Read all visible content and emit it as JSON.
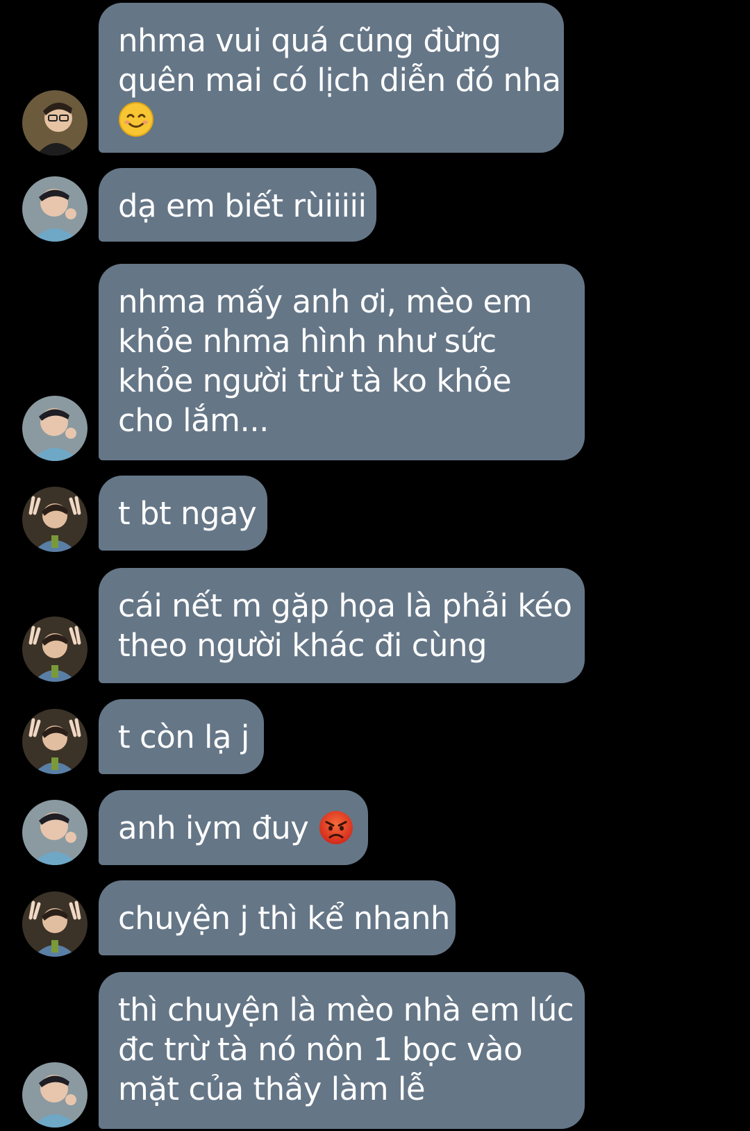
{
  "messages": [
    {
      "sender": "avatar-glasses",
      "lines": [
        "nhma vui quá cũng đừng",
        "quên mai có lịch diễn đó nha"
      ],
      "emoji": "smiling-face-emoji"
    },
    {
      "sender": "avatar-duy",
      "lines": [
        "dạ em biết rùiiiii"
      ]
    },
    {
      "sender": "avatar-duy",
      "lines": [
        "nhma mấy anh ơi, mèo em",
        "khỏe nhma hình như sức",
        "khỏe người trừ tà ko khỏe",
        "cho lắm..."
      ]
    },
    {
      "sender": "avatar-peace",
      "lines": [
        "t bt ngay"
      ]
    },
    {
      "sender": "avatar-peace",
      "lines": [
        "cái nết m gặp họa là phải kéo",
        "theo người khác đi cùng"
      ]
    },
    {
      "sender": "avatar-peace",
      "lines": [
        "t còn lạ j"
      ]
    },
    {
      "sender": "avatar-duy",
      "lines": [
        "anh iym đuy "
      ],
      "emoji": "angry-face-emoji"
    },
    {
      "sender": "avatar-peace",
      "lines": [
        "chuyện j thì kể nhanh"
      ]
    },
    {
      "sender": "avatar-duy",
      "lines": [
        "thì chuyện là mèo nhà em lúc",
        "đc trừ tà nó nôn 1 bọc vào",
        "mặt của thầy làm lễ"
      ]
    }
  ],
  "colors": {
    "background": "#000000",
    "bubble": "#657687",
    "text": "#ffffff"
  }
}
